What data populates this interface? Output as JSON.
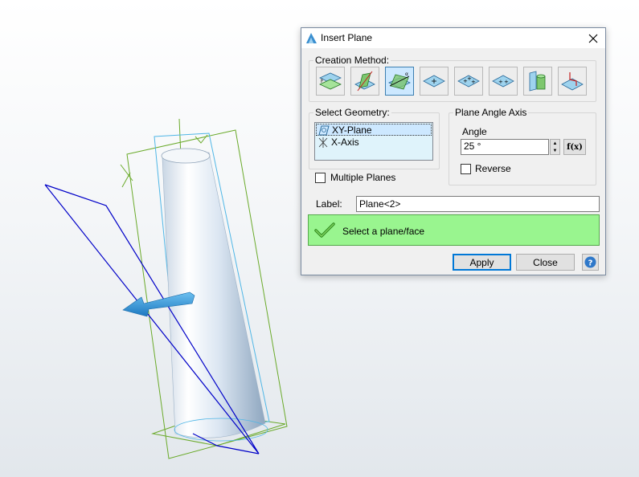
{
  "dialog": {
    "title": "Insert Plane",
    "creation_method_label": "Creation Method:",
    "methods": [
      {
        "icon": "plane-offset-icon"
      },
      {
        "icon": "plane-through-edge-icon"
      },
      {
        "icon": "plane-at-angle-icon",
        "active": true
      },
      {
        "icon": "plane-point-icon"
      },
      {
        "icon": "plane-three-points-icon"
      },
      {
        "icon": "plane-point-normal-icon"
      },
      {
        "icon": "plane-tangent-cylinder-icon"
      },
      {
        "icon": "plane-curve-normal-icon"
      }
    ],
    "select_geometry": {
      "label": "Select Geometry:",
      "items": [
        {
          "label": "XY-Plane",
          "icon": "plane-geometry-icon",
          "selected": true
        },
        {
          "label": "X-Axis",
          "icon": "axis-geometry-icon"
        }
      ]
    },
    "multiple_planes_label": "Multiple Planes",
    "plane_angle_axis": {
      "label": "Plane Angle Axis",
      "angle_label": "Angle",
      "angle_value": "25 °",
      "fx_label": "f(x)",
      "reverse_label": "Reverse"
    },
    "label_field": {
      "label": "Label:",
      "value": "Plane<2>"
    },
    "status_message": "Select a plane/face",
    "buttons": {
      "apply": "Apply",
      "close": "Close"
    }
  },
  "colors": {
    "status_bg": "#99f58f",
    "active_method_bg": "#cce8ff",
    "list_bg": "#dff3fb",
    "plane_outline": "#0000c8",
    "frame_outline": "#6aaa2a",
    "arrow": "#2f92d6"
  }
}
